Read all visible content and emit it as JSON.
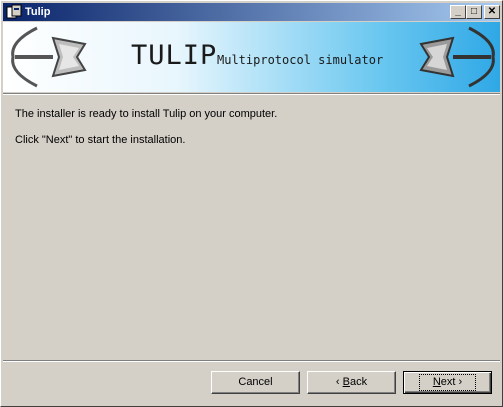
{
  "window": {
    "title": "Tulip"
  },
  "banner": {
    "title": "TULIP",
    "subtitle": "Multiprotocol simulator"
  },
  "body": {
    "line1": "The installer is ready to install Tulip on your computer.",
    "line2": "Click \"Next\" to start the installation."
  },
  "buttons": {
    "cancel": "Cancel",
    "back_mnemonic": "B",
    "back_rest": "ack",
    "next_mnemonic": "N",
    "next_rest": "ext"
  },
  "icons": {
    "back_arrow": "‹",
    "next_arrow": "›",
    "minimize": "_",
    "maximize": "□",
    "close": "✕"
  }
}
